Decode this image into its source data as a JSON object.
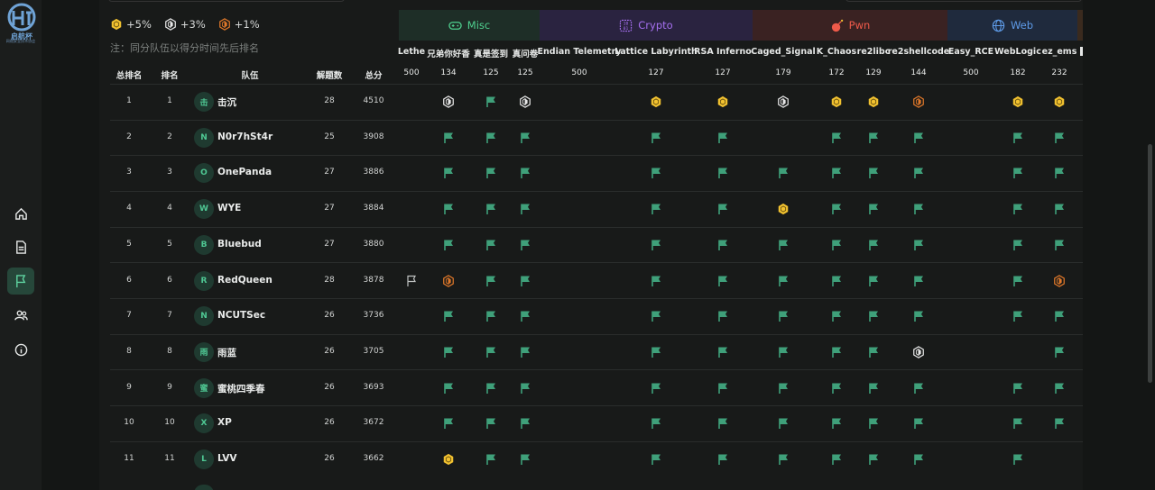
{
  "logo": {
    "caption": "网络安全技术协会"
  },
  "nav": [
    "home-icon",
    "document-icon",
    "flag-icon",
    "users-icon",
    "info-icon"
  ],
  "bonus": [
    {
      "label": "+5%",
      "color": "#f2c230",
      "icon": "gold-hexagon-icon"
    },
    {
      "label": "+3%",
      "color": "#e8e8e8",
      "icon": "silver-hexagon-icon"
    },
    {
      "label": "+1%",
      "color": "#e0782a",
      "icon": "bronze-hexagon-icon"
    }
  ],
  "note": "注：同分队伍以得分时间先后排名",
  "categories": [
    {
      "name": "Misc",
      "color": "#4fd08f",
      "bg": "#1e2e27",
      "icon": "gamepad-icon"
    },
    {
      "name": "Crypto",
      "color": "#a670f0",
      "bg": "#2a2340",
      "icon": "binary-icon"
    },
    {
      "name": "Pwn",
      "color": "#ef5a4a",
      "bg": "#3a2222",
      "icon": "bomb-icon"
    },
    {
      "name": "Web",
      "color": "#5e9be8",
      "bg": "#1f2a3d",
      "icon": "globe-icon"
    }
  ],
  "challenges": [
    {
      "name": "Lethe",
      "score": "500"
    },
    {
      "name": "兄弟你好香",
      "score": "134"
    },
    {
      "name": "真是签到",
      "score": "125"
    },
    {
      "name": "真问卷",
      "score": "125"
    },
    {
      "name": "Endian Telemetry",
      "score": "500"
    },
    {
      "name": "Lattice Labyrinth",
      "score": "127"
    },
    {
      "name": "RSA Inferno",
      "score": "127"
    },
    {
      "name": "Caged_Signal",
      "score": "179"
    },
    {
      "name": "K_Chaos",
      "score": "172"
    },
    {
      "name": "re2libc",
      "score": "129"
    },
    {
      "name": "re2shellcode",
      "score": "144"
    },
    {
      "name": "Easy_RCE",
      "score": "500"
    },
    {
      "name": "WebLogic",
      "score": "182"
    },
    {
      "name": "ez_ems",
      "score": "232"
    }
  ],
  "columns": {
    "overall_rank": "总排名",
    "rank": "排名",
    "team": "队伍",
    "solved": "解题数",
    "total": "总分"
  },
  "rows": [
    {
      "overall": "1",
      "rank": "1",
      "avatar": "击",
      "team": "击沉",
      "solved": "28",
      "score": "4510",
      "marks": [
        "",
        "S",
        "F",
        "S",
        "",
        "G",
        "G",
        "S",
        "G",
        "G",
        "B",
        "",
        "G",
        "G"
      ]
    },
    {
      "overall": "2",
      "rank": "2",
      "avatar": "N",
      "team": "N0r7hSt4r",
      "solved": "25",
      "score": "3908",
      "marks": [
        "",
        "F",
        "F",
        "F",
        "",
        "F",
        "F",
        "",
        "F",
        "F",
        "F",
        "",
        "F",
        "F"
      ]
    },
    {
      "overall": "3",
      "rank": "3",
      "avatar": "O",
      "team": "OnePanda",
      "solved": "27",
      "score": "3886",
      "marks": [
        "",
        "F",
        "F",
        "F",
        "",
        "F",
        "F",
        "F",
        "F",
        "F",
        "F",
        "",
        "F",
        "F"
      ]
    },
    {
      "overall": "4",
      "rank": "4",
      "avatar": "W",
      "team": "WYE",
      "solved": "27",
      "score": "3884",
      "marks": [
        "",
        "F",
        "F",
        "F",
        "",
        "F",
        "F",
        "G",
        "F",
        "F",
        "F",
        "",
        "F",
        "F"
      ]
    },
    {
      "overall": "5",
      "rank": "5",
      "avatar": "B",
      "team": "Bluebud",
      "solved": "27",
      "score": "3880",
      "marks": [
        "",
        "F",
        "F",
        "F",
        "",
        "F",
        "F",
        "F",
        "F",
        "F",
        "F",
        "",
        "F",
        "F"
      ]
    },
    {
      "overall": "6",
      "rank": "6",
      "avatar": "R",
      "team": "RedQueen",
      "solved": "28",
      "score": "3878",
      "marks": [
        "O",
        "B",
        "F",
        "F",
        "",
        "F",
        "F",
        "F",
        "F",
        "F",
        "F",
        "",
        "F",
        "B"
      ]
    },
    {
      "overall": "7",
      "rank": "7",
      "avatar": "N",
      "team": "NCUTSec",
      "solved": "26",
      "score": "3736",
      "marks": [
        "",
        "F",
        "F",
        "F",
        "",
        "F",
        "F",
        "F",
        "F",
        "F",
        "F",
        "",
        "F",
        "F"
      ]
    },
    {
      "overall": "8",
      "rank": "8",
      "avatar": "雨",
      "team": "雨蓝",
      "solved": "26",
      "score": "3705",
      "marks": [
        "",
        "F",
        "F",
        "F",
        "",
        "F",
        "F",
        "F",
        "F",
        "F",
        "S",
        "",
        "",
        "F"
      ]
    },
    {
      "overall": "9",
      "rank": "9",
      "avatar": "蜜",
      "team": "蜜桃四季春",
      "solved": "26",
      "score": "3693",
      "marks": [
        "",
        "F",
        "F",
        "F",
        "",
        "F",
        "F",
        "F",
        "F",
        "F",
        "F",
        "",
        "F",
        "F"
      ]
    },
    {
      "overall": "10",
      "rank": "10",
      "avatar": "X",
      "team": "XP",
      "solved": "26",
      "score": "3672",
      "marks": [
        "",
        "F",
        "F",
        "F",
        "",
        "F",
        "F",
        "F",
        "F",
        "F",
        "F",
        "",
        "F",
        "F"
      ]
    },
    {
      "overall": "11",
      "rank": "11",
      "avatar": "L",
      "team": "LVV",
      "solved": "26",
      "score": "3662",
      "marks": [
        "",
        "G",
        "F",
        "F",
        "",
        "F",
        "F",
        "F",
        "F",
        "F",
        "F",
        "",
        "F",
        ""
      ]
    }
  ],
  "mark_colors": {
    "flag": "#3fa07a",
    "gold": "#f2c230",
    "silver": "#e8e8e8",
    "bronze": "#e0782a",
    "outline": "#bfc2c1"
  }
}
